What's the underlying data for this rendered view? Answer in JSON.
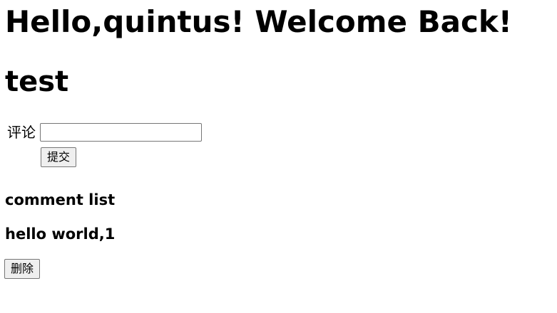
{
  "greeting": "Hello,quintus! Welcome Back!",
  "title": "test",
  "form": {
    "label": "评论",
    "input_value": "",
    "submit_label": "提交"
  },
  "comment_list": {
    "title": "comment list",
    "items": [
      {
        "text": "hello world,1",
        "delete_label": "删除"
      }
    ]
  }
}
